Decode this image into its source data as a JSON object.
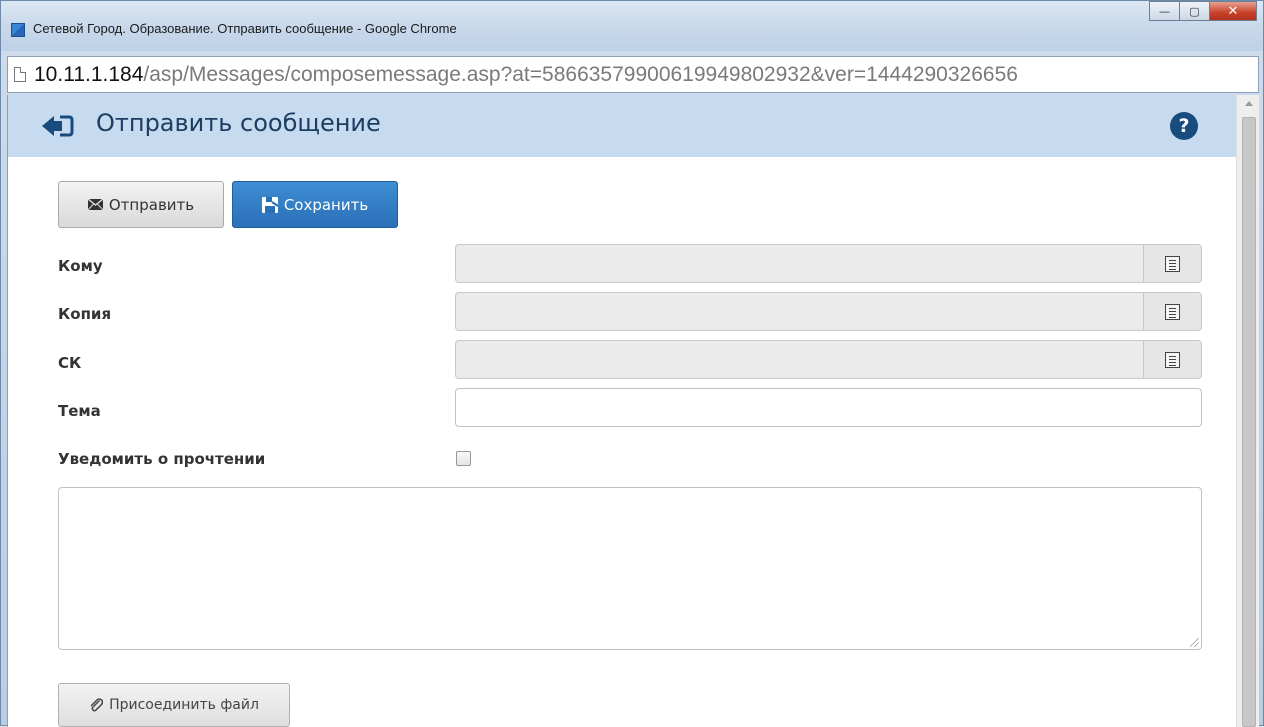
{
  "window": {
    "title": "Сетевой Город. Образование. Отправить сообщение - Google Chrome",
    "controls": {
      "minimize": "—",
      "maximize": "▢",
      "close": "✕"
    }
  },
  "address_bar": {
    "host": "10.11.1.184",
    "path": "/asp/Messages/composemessage.asp?at=58663579900619949802932&ver=1444290326656"
  },
  "page": {
    "title": "Отправить сообщение",
    "help": "?"
  },
  "toolbar": {
    "send_label": "Отправить",
    "save_label": "Сохранить"
  },
  "form": {
    "to_label": "Кому",
    "to_value": "",
    "cc_label": "Копия",
    "cc_value": "",
    "bcc_label": "СК",
    "bcc_value": "",
    "subject_label": "Тема",
    "subject_value": "",
    "read_receipt_label": "Уведомить о прочтении",
    "read_receipt_checked": false,
    "body_value": ""
  },
  "attach": {
    "label": "Присоединить файл"
  },
  "colors": {
    "header_bg": "#c6dbef",
    "title_color": "#1d3d62",
    "primary_button": "#2a70b9"
  }
}
